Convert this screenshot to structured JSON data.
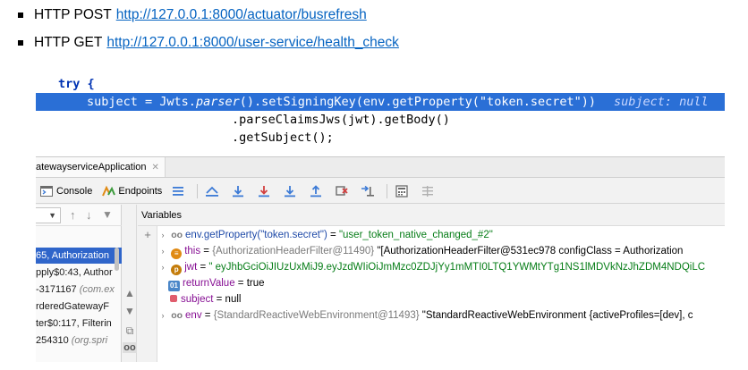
{
  "bullets": [
    {
      "method": "HTTP POST",
      "url": "http://127.0.0.1:8000/actuator/busrefresh"
    },
    {
      "method": "HTTP GET",
      "url": "http://127.0.0.1:8000/user-service/health_check"
    }
  ],
  "code": {
    "line1": "try {",
    "line2_var": "subject",
    "line2_eq": " = Jwts.",
    "line2_call": "parser",
    "line2_rest": "().setSigningKey(env.getProperty(\"token.secret\"))",
    "line2_hint": "subject: null",
    "line3": ".parseClaimsJws(jwt).getBody()",
    "line4": ".getSubject();"
  },
  "debugger": {
    "run_tab": "atewayserviceApplication",
    "toolbar": {
      "console_label": "Console",
      "endpoints_label": "Endpoints"
    },
    "variables_header": "Variables",
    "frames": [
      {
        "text": "65, Authorization",
        "pkg": "",
        "selected": true
      },
      {
        "text": "pply$0:43, Author",
        "pkg": "",
        "selected": false
      },
      {
        "text": "-3171167 ",
        "pkg": "(com.ex",
        "selected": false
      },
      {
        "text": "rderedGatewayF",
        "pkg": "",
        "selected": false
      },
      {
        "text": "ter$0:117, Filterin",
        "pkg": "",
        "selected": false
      },
      {
        "text": "254310 ",
        "pkg": "(org.spri",
        "selected": false
      }
    ],
    "variables": {
      "watch": {
        "expr": "env.getProperty(\"token.secret\")",
        "value": "\"user_token_native_changed_#2\""
      },
      "this": {
        "name": "this",
        "type": "{AuthorizationHeaderFilter@11490}",
        "value": "\"[AuthorizationHeaderFilter@531ec978 configClass = Authorization"
      },
      "jwt": {
        "name": "jwt",
        "value": "\" eyJhbGciOiJIUzUxMiJ9.eyJzdWIiOiJmMzc0ZDJjYy1mMTI0LTQ1YWMtYTg1NS1lMDVkNzJhZDM4NDQiLC"
      },
      "returnValue": {
        "name": "returnValue",
        "value": "true"
      },
      "subject": {
        "name": "subject",
        "value": "null"
      },
      "env": {
        "name": "env",
        "type": "{StandardReactiveWebEnvironment@11493}",
        "value": "\"StandardReactiveWebEnvironment {activeProfiles=[dev], c"
      }
    }
  }
}
